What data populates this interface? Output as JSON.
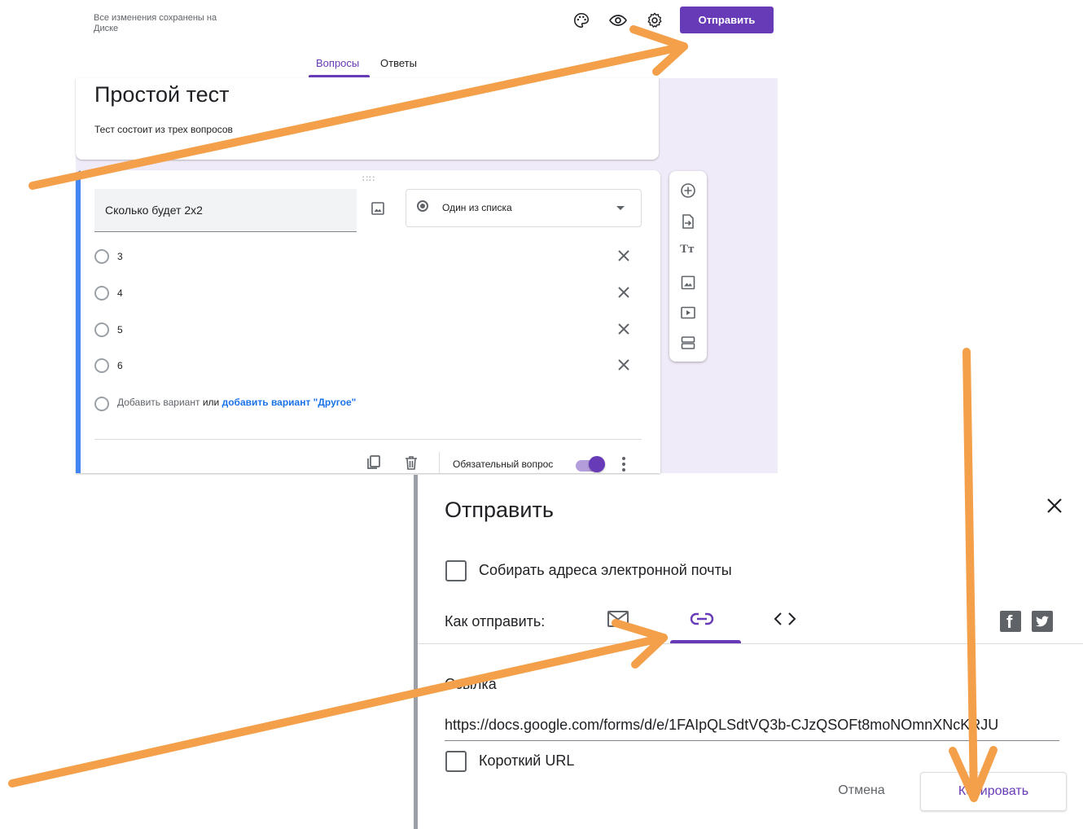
{
  "header": {
    "saved_status": "Все изменения сохранены на Диске",
    "send_button": "Отправить",
    "icons": [
      "palette-icon",
      "eye-icon",
      "gear-icon"
    ]
  },
  "tabs": [
    {
      "label": "Вопросы",
      "active": true
    },
    {
      "label": "Ответы",
      "active": false
    }
  ],
  "form": {
    "title": "Простой тест",
    "description": "Тест состоит из трех вопросов"
  },
  "question": {
    "text": "Сколько будет 2x2",
    "type": "Один из списка",
    "options": [
      "3",
      "4",
      "5",
      "6"
    ],
    "add_option": "Добавить вариант",
    "or": "или",
    "add_other": "добавить вариант \"Другое\"",
    "required_label": "Обязательный вопрос",
    "required": true
  },
  "toolbar": {
    "icons": [
      "add-question-icon",
      "import-questions-icon",
      "add-title-icon",
      "add-image-icon",
      "add-video-icon",
      "add-section-icon"
    ]
  },
  "send_dialog": {
    "title": "Отправить",
    "collect_emails": "Собирать адреса электронной почты",
    "send_via": "Как отправить:",
    "active_method": "link",
    "link_heading": "Ссылка",
    "url": "https://docs.google.com/forms/d/e/1FAIpQLSdtVQ3b-CJzQSOFt8moNOmnXNcKRJU",
    "short_url": "Короткий URL",
    "cancel": "Отмена",
    "copy": "Копировать"
  },
  "colors": {
    "accent": "#673ab7",
    "blue": "#4285f4",
    "arrow": "#f4a04a"
  }
}
